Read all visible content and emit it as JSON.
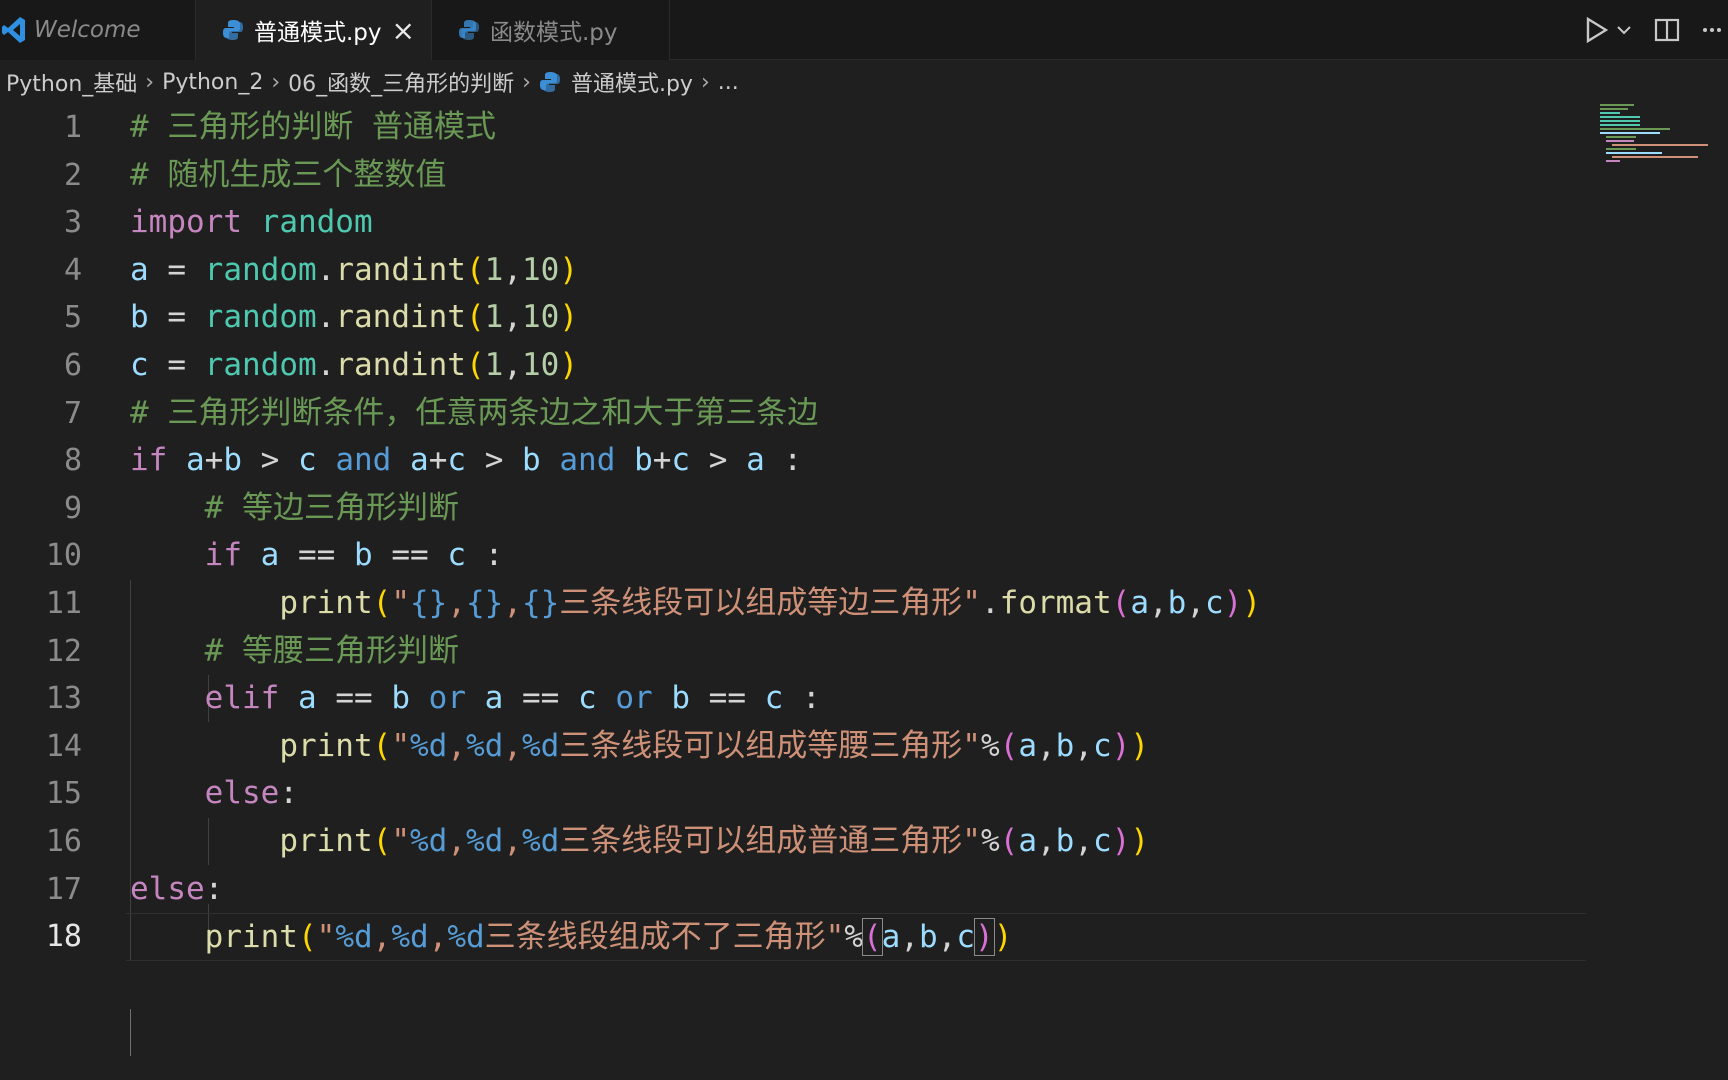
{
  "tabs": [
    {
      "label": "Welcome"
    },
    {
      "label": "普通模式.py"
    },
    {
      "label": "函数模式.py"
    }
  ],
  "breadcrumb": [
    "Python_基础",
    "Python_2",
    "06_函数_三角形的判断",
    "普通模式.py",
    "..."
  ],
  "editor": {
    "line_numbers": [
      "1",
      "2",
      "3",
      "4",
      "5",
      "6",
      "7",
      "8",
      "9",
      "10",
      "11",
      "12",
      "13",
      "14",
      "15",
      "16",
      "17",
      "18"
    ],
    "current_line": 18,
    "lines": [
      [
        {
          "t": "cmt",
          "v": "# 三角形的判断 普通模式"
        }
      ],
      [
        {
          "t": "cmt",
          "v": "# 随机生成三个整数值"
        }
      ],
      [
        {
          "t": "kw",
          "v": "import"
        },
        {
          "t": "op",
          "v": " "
        },
        {
          "t": "mod",
          "v": "random"
        }
      ],
      [
        {
          "t": "var",
          "v": "a"
        },
        {
          "t": "op",
          "v": " = "
        },
        {
          "t": "mod",
          "v": "random"
        },
        {
          "t": "op",
          "v": "."
        },
        {
          "t": "fn",
          "v": "randint"
        },
        {
          "t": "p1",
          "v": "("
        },
        {
          "t": "num",
          "v": "1"
        },
        {
          "t": "op",
          "v": ","
        },
        {
          "t": "num",
          "v": "10"
        },
        {
          "t": "p1",
          "v": ")"
        }
      ],
      [
        {
          "t": "var",
          "v": "b"
        },
        {
          "t": "op",
          "v": " = "
        },
        {
          "t": "mod",
          "v": "random"
        },
        {
          "t": "op",
          "v": "."
        },
        {
          "t": "fn",
          "v": "randint"
        },
        {
          "t": "p1",
          "v": "("
        },
        {
          "t": "num",
          "v": "1"
        },
        {
          "t": "op",
          "v": ","
        },
        {
          "t": "num",
          "v": "10"
        },
        {
          "t": "p1",
          "v": ")"
        }
      ],
      [
        {
          "t": "var",
          "v": "c"
        },
        {
          "t": "op",
          "v": " = "
        },
        {
          "t": "mod",
          "v": "random"
        },
        {
          "t": "op",
          "v": "."
        },
        {
          "t": "fn",
          "v": "randint"
        },
        {
          "t": "p1",
          "v": "("
        },
        {
          "t": "num",
          "v": "1"
        },
        {
          "t": "op",
          "v": ","
        },
        {
          "t": "num",
          "v": "10"
        },
        {
          "t": "p1",
          "v": ")"
        }
      ],
      [
        {
          "t": "cmt",
          "v": "# 三角形判断条件，任意两条边之和大于第三条边"
        }
      ],
      [
        {
          "t": "kw",
          "v": "if"
        },
        {
          "t": "op",
          "v": " "
        },
        {
          "t": "var",
          "v": "a"
        },
        {
          "t": "op",
          "v": "+"
        },
        {
          "t": "var",
          "v": "b"
        },
        {
          "t": "op",
          "v": " > "
        },
        {
          "t": "var",
          "v": "c"
        },
        {
          "t": "op",
          "v": " "
        },
        {
          "t": "kwb",
          "v": "and"
        },
        {
          "t": "op",
          "v": " "
        },
        {
          "t": "var",
          "v": "a"
        },
        {
          "t": "op",
          "v": "+"
        },
        {
          "t": "var",
          "v": "c"
        },
        {
          "t": "op",
          "v": " > "
        },
        {
          "t": "var",
          "v": "b"
        },
        {
          "t": "op",
          "v": " "
        },
        {
          "t": "kwb",
          "v": "and"
        },
        {
          "t": "op",
          "v": " "
        },
        {
          "t": "var",
          "v": "b"
        },
        {
          "t": "op",
          "v": "+"
        },
        {
          "t": "var",
          "v": "c"
        },
        {
          "t": "op",
          "v": " > "
        },
        {
          "t": "var",
          "v": "a"
        },
        {
          "t": "op",
          "v": " :"
        }
      ],
      [
        {
          "t": "op",
          "v": "    "
        },
        {
          "t": "cmt",
          "v": "# 等边三角形判断"
        }
      ],
      [
        {
          "t": "op",
          "v": "    "
        },
        {
          "t": "kw",
          "v": "if"
        },
        {
          "t": "op",
          "v": " "
        },
        {
          "t": "var",
          "v": "a"
        },
        {
          "t": "op",
          "v": " == "
        },
        {
          "t": "var",
          "v": "b"
        },
        {
          "t": "op",
          "v": " == "
        },
        {
          "t": "var",
          "v": "c"
        },
        {
          "t": "op",
          "v": " :"
        }
      ],
      [
        {
          "t": "op",
          "v": "        "
        },
        {
          "t": "fn",
          "v": "print"
        },
        {
          "t": "p1",
          "v": "("
        },
        {
          "t": "str",
          "v": "\""
        },
        {
          "t": "fmt",
          "v": "{}"
        },
        {
          "t": "str",
          "v": ","
        },
        {
          "t": "fmt",
          "v": "{}"
        },
        {
          "t": "str",
          "v": ","
        },
        {
          "t": "fmt",
          "v": "{}"
        },
        {
          "t": "str",
          "v": "三条线段可以组成等边三角形\""
        },
        {
          "t": "op",
          "v": "."
        },
        {
          "t": "fn",
          "v": "format"
        },
        {
          "t": "p2",
          "v": "("
        },
        {
          "t": "var",
          "v": "a"
        },
        {
          "t": "op",
          "v": ","
        },
        {
          "t": "var",
          "v": "b"
        },
        {
          "t": "op",
          "v": ","
        },
        {
          "t": "var",
          "v": "c"
        },
        {
          "t": "p2",
          "v": ")"
        },
        {
          "t": "p1",
          "v": ")"
        }
      ],
      [
        {
          "t": "op",
          "v": "    "
        },
        {
          "t": "cmt",
          "v": "# 等腰三角形判断"
        }
      ],
      [
        {
          "t": "op",
          "v": "    "
        },
        {
          "t": "kw",
          "v": "elif"
        },
        {
          "t": "op",
          "v": " "
        },
        {
          "t": "var",
          "v": "a"
        },
        {
          "t": "op",
          "v": " == "
        },
        {
          "t": "var",
          "v": "b"
        },
        {
          "t": "op",
          "v": " "
        },
        {
          "t": "kwb",
          "v": "or"
        },
        {
          "t": "op",
          "v": " "
        },
        {
          "t": "var",
          "v": "a"
        },
        {
          "t": "op",
          "v": " == "
        },
        {
          "t": "var",
          "v": "c"
        },
        {
          "t": "op",
          "v": " "
        },
        {
          "t": "kwb",
          "v": "or"
        },
        {
          "t": "op",
          "v": " "
        },
        {
          "t": "var",
          "v": "b"
        },
        {
          "t": "op",
          "v": " == "
        },
        {
          "t": "var",
          "v": "c"
        },
        {
          "t": "op",
          "v": " :"
        }
      ],
      [
        {
          "t": "op",
          "v": "        "
        },
        {
          "t": "fn",
          "v": "print"
        },
        {
          "t": "p1",
          "v": "("
        },
        {
          "t": "str",
          "v": "\""
        },
        {
          "t": "fmt",
          "v": "%d"
        },
        {
          "t": "str",
          "v": ","
        },
        {
          "t": "fmt",
          "v": "%d"
        },
        {
          "t": "str",
          "v": ","
        },
        {
          "t": "fmt",
          "v": "%d"
        },
        {
          "t": "str",
          "v": "三条线段可以组成等腰三角形\""
        },
        {
          "t": "op",
          "v": "%"
        },
        {
          "t": "p2",
          "v": "("
        },
        {
          "t": "var",
          "v": "a"
        },
        {
          "t": "op",
          "v": ","
        },
        {
          "t": "var",
          "v": "b"
        },
        {
          "t": "op",
          "v": ","
        },
        {
          "t": "var",
          "v": "c"
        },
        {
          "t": "p2",
          "v": ")"
        },
        {
          "t": "p1",
          "v": ")"
        }
      ],
      [
        {
          "t": "op",
          "v": "    "
        },
        {
          "t": "kw",
          "v": "else"
        },
        {
          "t": "op",
          "v": ":"
        }
      ],
      [
        {
          "t": "op",
          "v": "        "
        },
        {
          "t": "fn",
          "v": "print"
        },
        {
          "t": "p1",
          "v": "("
        },
        {
          "t": "str",
          "v": "\""
        },
        {
          "t": "fmt",
          "v": "%d"
        },
        {
          "t": "str",
          "v": ","
        },
        {
          "t": "fmt",
          "v": "%d"
        },
        {
          "t": "str",
          "v": ","
        },
        {
          "t": "fmt",
          "v": "%d"
        },
        {
          "t": "str",
          "v": "三条线段可以组成普通三角形\""
        },
        {
          "t": "op",
          "v": "%"
        },
        {
          "t": "p2",
          "v": "("
        },
        {
          "t": "var",
          "v": "a"
        },
        {
          "t": "op",
          "v": ","
        },
        {
          "t": "var",
          "v": "b"
        },
        {
          "t": "op",
          "v": ","
        },
        {
          "t": "var",
          "v": "c"
        },
        {
          "t": "p2",
          "v": ")"
        },
        {
          "t": "p1",
          "v": ")"
        }
      ],
      [
        {
          "t": "kw",
          "v": "else"
        },
        {
          "t": "op",
          "v": ":"
        }
      ],
      [
        {
          "t": "op",
          "v": "    "
        },
        {
          "t": "fn",
          "v": "print"
        },
        {
          "t": "p1",
          "v": "("
        },
        {
          "t": "str",
          "v": "\""
        },
        {
          "t": "fmt",
          "v": "%d"
        },
        {
          "t": "str",
          "v": ","
        },
        {
          "t": "fmt",
          "v": "%d"
        },
        {
          "t": "str",
          "v": ","
        },
        {
          "t": "fmt",
          "v": "%d"
        },
        {
          "t": "str",
          "v": "三条线段组成不了三角形\""
        },
        {
          "t": "op",
          "v": "%"
        },
        {
          "t": "p2b",
          "v": "("
        },
        {
          "t": "var",
          "v": "a"
        },
        {
          "t": "op",
          "v": ","
        },
        {
          "t": "var",
          "v": "b"
        },
        {
          "t": "op",
          "v": ","
        },
        {
          "t": "var",
          "v": "c"
        },
        {
          "t": "p2b",
          "v": ")"
        },
        {
          "t": "p1",
          "v": ")"
        }
      ]
    ]
  },
  "icons": {
    "vscode": "vscode-logo-icon",
    "python": "python-file-icon",
    "close": "close-icon",
    "run": "run-icon",
    "run_dropdown": "chevron-down-icon",
    "split": "split-editor-icon",
    "more": "more-actions-icon"
  },
  "colors": {
    "keyword": "#c586c0",
    "keyword_blue": "#569cd6",
    "comment": "#6a9955",
    "string": "#ce9178",
    "variable": "#9cdcfe",
    "function": "#dcdcaa",
    "module": "#4ec9b0",
    "number": "#b5cea8",
    "bracket_1": "#ffd700",
    "bracket_2": "#da70d6"
  }
}
